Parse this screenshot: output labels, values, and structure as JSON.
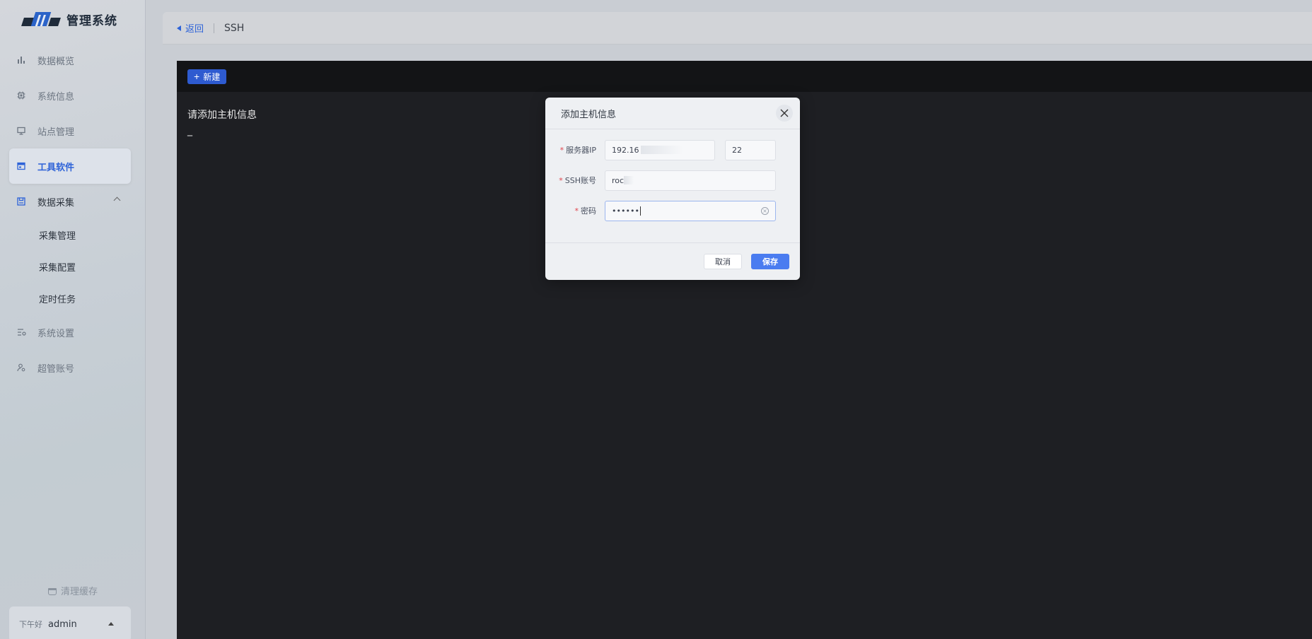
{
  "app": {
    "logo_text": "管理系统"
  },
  "sidebar": {
    "items": [
      {
        "label": "数据概览",
        "icon": "bar-chart-icon"
      },
      {
        "label": "系统信息",
        "icon": "chip-icon"
      },
      {
        "label": "站点管理",
        "icon": "monitor-icon"
      },
      {
        "label": "工具软件",
        "icon": "window-icon",
        "active": true
      },
      {
        "label": "数据采集",
        "icon": "save-icon",
        "expanded": true
      }
    ],
    "subitems": [
      {
        "label": "采集管理"
      },
      {
        "label": "采集配置"
      },
      {
        "label": "定时任务"
      }
    ],
    "bottom_items": [
      {
        "label": "系统设置",
        "icon": "settings-list-icon"
      },
      {
        "label": "超管账号",
        "icon": "user-gear-icon"
      }
    ],
    "clear_cache": "清理缓存",
    "user": {
      "greeting": "下午好",
      "name": "admin"
    }
  },
  "topbar": {
    "back_label": "返回",
    "title": "SSH"
  },
  "terminal": {
    "new_button": "新建",
    "message": "请添加主机信息",
    "cursor": "_"
  },
  "modal": {
    "title": "添加主机信息",
    "fields": {
      "server_ip": {
        "label": "服务器IP",
        "value": "192.16",
        "port": "22"
      },
      "ssh_account": {
        "label": "SSH账号",
        "value": "roc"
      },
      "password": {
        "label": "密码",
        "value": "••••••"
      }
    },
    "cancel": "取消",
    "save": "保存"
  },
  "colors": {
    "accent": "#2e63d8",
    "primary_button": "#4a7cf0",
    "terminal_bg": "#1e1f23",
    "required": "#e0434b"
  }
}
